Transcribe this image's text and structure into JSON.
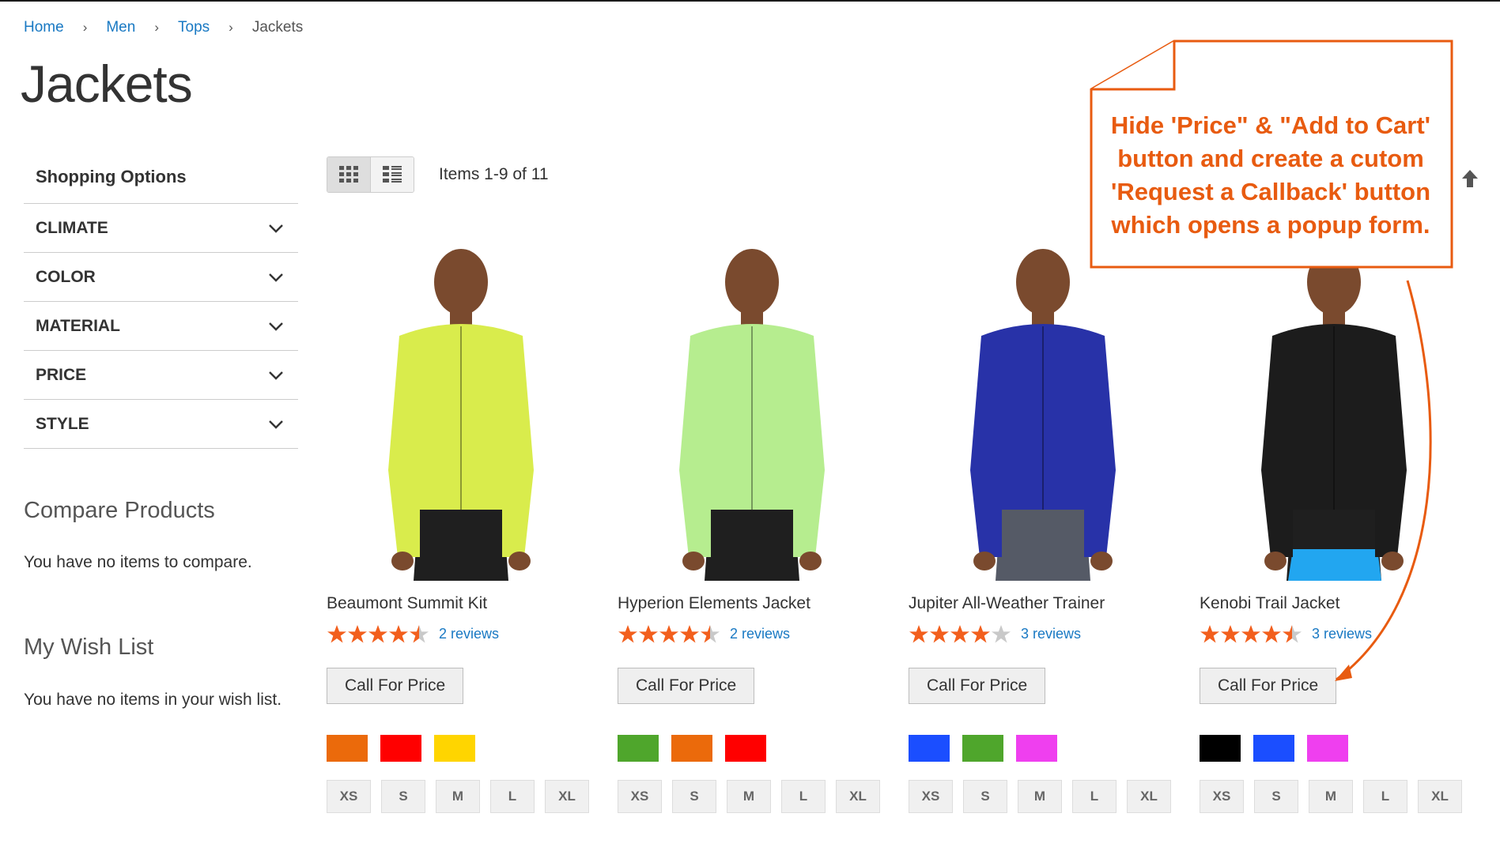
{
  "breadcrumb": {
    "items": [
      {
        "label": "Home"
      },
      {
        "label": "Men"
      },
      {
        "label": "Tops"
      }
    ],
    "current": "Jackets"
  },
  "page_title": "Jackets",
  "sidebar": {
    "shopping_options_title": "Shopping Options",
    "filters": [
      {
        "label": "CLIMATE"
      },
      {
        "label": "COLOR"
      },
      {
        "label": "MATERIAL"
      },
      {
        "label": "PRICE"
      },
      {
        "label": "STYLE"
      }
    ],
    "compare": {
      "title": "Compare Products",
      "text": "You have no items to compare."
    },
    "wishlist": {
      "title": "My Wish List",
      "text": "You have no items in your wish list."
    }
  },
  "toolbar": {
    "items_count": "Items 1-9 of 11",
    "modes": [
      {
        "icon": "grid-view-icon"
      },
      {
        "icon": "list-view-icon"
      }
    ]
  },
  "products": [
    {
      "name": "Beaumont Summit Kit",
      "rating": 4.5,
      "reviews": "2 reviews",
      "button": "Call For Price",
      "jacket_color": "#d9ec4c",
      "swatches": [
        "#eb6a0b",
        "#ff0000",
        "#ffd500"
      ],
      "sizes": [
        "XS",
        "S",
        "M",
        "L",
        "XL"
      ]
    },
    {
      "name": "Hyperion Elements Jacket",
      "rating": 4.5,
      "reviews": "2 reviews",
      "button": "Call For Price",
      "jacket_color": "#b6ed8f",
      "swatches": [
        "#4fa62c",
        "#eb6a0b",
        "#ff0000"
      ],
      "sizes": [
        "XS",
        "S",
        "M",
        "L",
        "XL"
      ]
    },
    {
      "name": "Jupiter All-Weather Trainer",
      "rating": 4,
      "reviews": "3 reviews",
      "button": "Call For Price",
      "jacket_color": "#2832a8",
      "swatches": [
        "#1b4eff",
        "#4fa62c",
        "#ef3fef"
      ],
      "sizes": [
        "XS",
        "S",
        "M",
        "L",
        "XL"
      ]
    },
    {
      "name": "Kenobi Trail Jacket",
      "rating": 4.5,
      "reviews": "3 reviews",
      "button": "Call For Price",
      "jacket_color": "#1c1c1c",
      "swatches": [
        "#000000",
        "#1b4eff",
        "#ef3fef"
      ],
      "sizes": [
        "XS",
        "S",
        "M",
        "L",
        "XL"
      ]
    }
  ],
  "callout": {
    "lines": [
      "Hide 'Price\" & \"Add to Cart'",
      "button and create a cutom",
      "'Request a Callback' button",
      "which opens a popup form."
    ],
    "color": "#e85b10"
  },
  "colors": {
    "link": "#1979c3",
    "star": "#f25f1d",
    "star_empty": "#c9c9c9"
  }
}
